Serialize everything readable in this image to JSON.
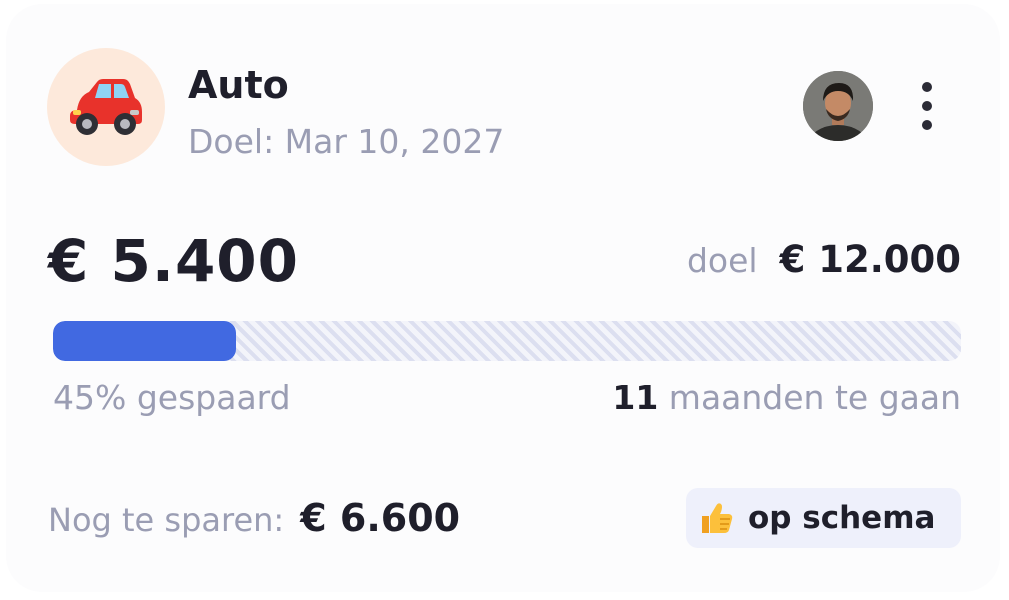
{
  "goal": {
    "icon": "car-icon",
    "title": "Auto",
    "deadline": "Doel: Mar 10, 2027"
  },
  "header": {
    "avatar": "user-avatar",
    "more_icon": "more-vertical-icon"
  },
  "amounts": {
    "saved": "€ 5.400",
    "target_label": "doel",
    "target_value": "€ 12.000"
  },
  "progress": {
    "percent": 45,
    "label": "45% gespaard",
    "months_num": "11",
    "months_label": "maanden te gaan"
  },
  "remaining": {
    "label": "Nog te sparen:",
    "value": "€ 6.600"
  },
  "status": {
    "icon": "thumbs-up-icon",
    "label": "op schema"
  },
  "colors": {
    "accent": "#4169e1",
    "icon_bg": "#fde9db",
    "badge_bg": "#eef0fb",
    "muted_text": "#9a9db3"
  }
}
